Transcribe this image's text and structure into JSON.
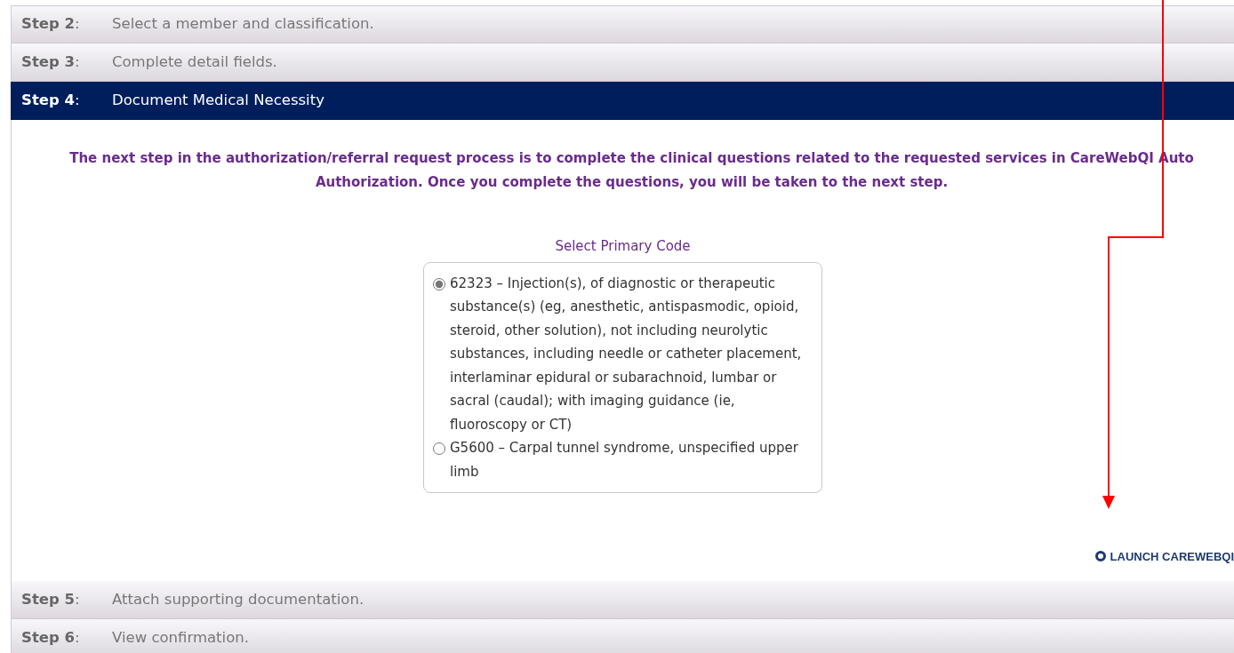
{
  "steps_before": [
    {
      "label": "**Step 2**:",
      "title": "Select a member and classification.",
      "active": false
    },
    {
      "label": "**Step 3**:",
      "title": "Complete detail fields.",
      "active": false
    },
    {
      "label": "**Step 4**:",
      "title": "Document Medical Necessity",
      "active": true
    }
  ],
  "panel": {
    "intro": "The next step in the authorization/referral request process is to complete the clinical questions related to the requested services in CareWebQI Auto Authorization. Once you complete the questions, you will be taken to the next step.",
    "select_label": "Select Primary Code",
    "options": [
      {
        "text": "62323 – Injection(s), of diagnostic or therapeutic substance(s) (eg, anesthetic, antispasmodic, opioid, steroid, other solution), not including neurolytic substances, including needle or catheter placement, interlaminar epidural or subarachnoid, lumbar or sacral (caudal); with imaging guidance (ie, fluoroscopy or CT)",
        "selected": true
      },
      {
        "text": "G5600 – Carpal tunnel syndrome, unspecified upper limb",
        "selected": false
      }
    ],
    "launch_link": "LAUNCH CAREWEBQI"
  },
  "steps_after": [
    {
      "label": "**Step 5**:",
      "title": "Attach supporting documentation.",
      "active": false
    },
    {
      "label": "**Step 6**:",
      "title": "View confirmation.",
      "active": false
    }
  ]
}
